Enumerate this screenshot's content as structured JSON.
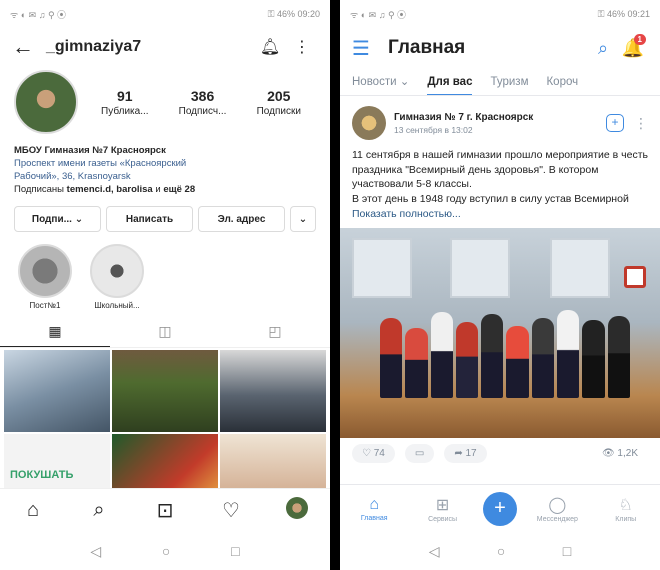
{
  "instagram": {
    "status_left": "ᯤ ◐ ✉ ♫ ⚲ ⦿",
    "status_right": "⚿ 46% 09:20",
    "username": "_gimnaziya7",
    "stats": [
      {
        "num": "91",
        "label": "Публика..."
      },
      {
        "num": "386",
        "label": "Подписч..."
      },
      {
        "num": "205",
        "label": "Подписки"
      }
    ],
    "bio_name": "МБОУ Гимназия №7 Красноярск",
    "bio_line1": "Проспект имени газеты «Красноярский",
    "bio_line2": "Рабочий», 36, Krasnoyarsk",
    "bio_followed_prefix": "Подписаны",
    "bio_followed_names": "temenci.d, barolisa",
    "bio_followed_joiner": "и",
    "bio_followed_more": "ещё 28",
    "buttons": {
      "follow": "Подпи... ⌄",
      "message": "Написать",
      "email": "Эл. адрес",
      "more": "⌄"
    },
    "highlights": [
      {
        "label": "Пост№1"
      },
      {
        "label": "Школьный..."
      }
    ],
    "tabs": {
      "grid": "▦",
      "reels": "◫",
      "tagged": "◰"
    },
    "grid_caption": "ПОКУШАТЬ",
    "bottom": {
      "home": "⌂",
      "search": "⌕",
      "reels": "⊡",
      "likes": "♡"
    },
    "sysnav": {
      "back": "◁",
      "home": "○",
      "recent": "□"
    }
  },
  "vk": {
    "status_left": "ᯤ ◐ ✉ ♫ ⚲ ⦿",
    "status_right": "⚿ 46% 09:21",
    "title": "Главная",
    "icons": {
      "burger": "☰",
      "search": "⌕",
      "bell": "🔔"
    },
    "notification_count": "1",
    "tabs": [
      {
        "label": "Новости ⌄",
        "active": false
      },
      {
        "label": "Для вас",
        "active": true
      },
      {
        "label": "Туризм",
        "active": false
      },
      {
        "label": "Короч",
        "active": false
      }
    ],
    "post_author": "Гимназия № 7 г. Красноярск",
    "post_date": "13 сентября в 13:02",
    "post_plus": "+",
    "post_more": "⋮",
    "post_text_1": "11 сентября в нашей гимназии прошло мероприятие в честь праздника \"Всемирный день здоровья\". В котором участвовали 5-8 классы.",
    "post_text_2": "В этот день в 1948 году вступил в силу устав Всемирной",
    "post_show_more": "Показать полностью...",
    "actions": {
      "likes": "♡ 74",
      "comments": "▭",
      "shares": "➦ 17",
      "views": "👁 1,2K"
    },
    "bottom": [
      {
        "icon": "⌂",
        "label": "Главная",
        "active": true
      },
      {
        "icon": "⊞",
        "label": "Сервисы",
        "active": false
      },
      {
        "icon": "+",
        "label": "",
        "active": false
      },
      {
        "icon": "◯",
        "label": "Мессенджер",
        "active": false
      },
      {
        "icon": "♘",
        "label": "Клипы",
        "active": false
      }
    ],
    "sysnav": {
      "back": "◁",
      "home": "○",
      "recent": "□"
    }
  },
  "colors": {
    "vk_accent": "#3f8ae0",
    "ig_text": "#262626",
    "badge": "#e64646"
  }
}
